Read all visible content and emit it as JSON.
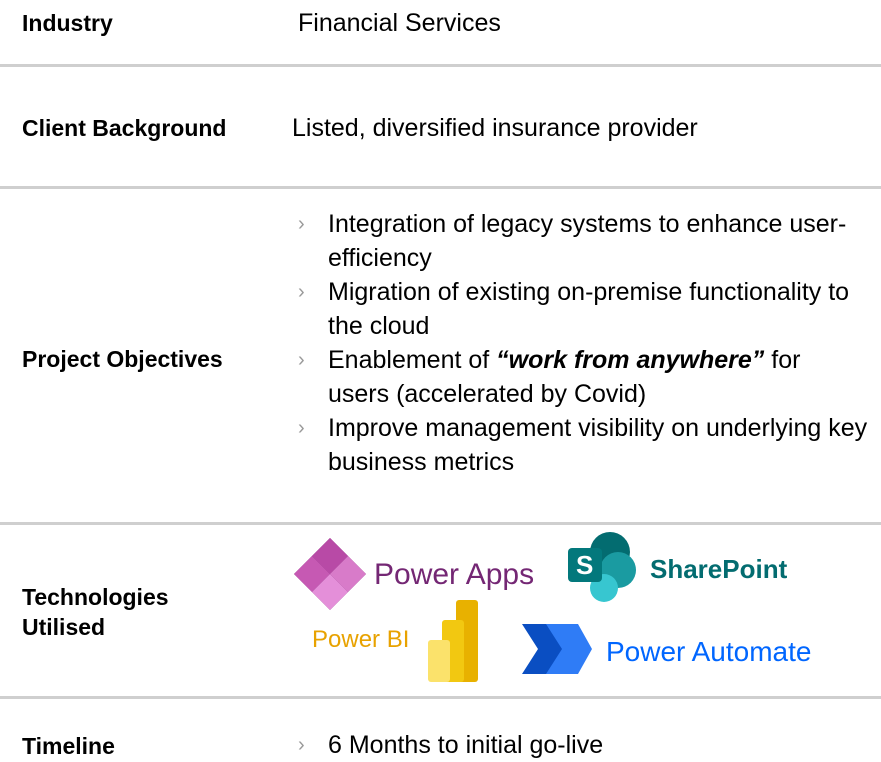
{
  "rows": {
    "industry": {
      "label": "Industry",
      "value": "Financial Services"
    },
    "client": {
      "label": "Client Background",
      "value": "Listed, diversified insurance provider"
    },
    "objectives": {
      "label": "Project Objectives",
      "items": [
        {
          "text": "Integration of legacy systems to enhance user-efficiency"
        },
        {
          "text": "Migration of existing on-premise functionality to the cloud"
        },
        {
          "pre": "Enablement of ",
          "emph": "“work from anywhere”",
          "post": " for users (accelerated by Covid)"
        },
        {
          "text": "Improve management visibility on underlying key business metrics"
        }
      ]
    },
    "technologies": {
      "label_line1": "Technologies",
      "label_line2": "Utilised",
      "logos": {
        "power_apps": "Power Apps",
        "sharepoint": "SharePoint",
        "sharepoint_letter": "S",
        "power_bi": "Power BI",
        "power_automate": "Power Automate"
      }
    },
    "timeline": {
      "label": "Timeline",
      "value": "6 Months to initial go-live"
    }
  },
  "colors": {
    "divider": "#cfcfcf",
    "power_apps_text": "#742774",
    "sharepoint_green": "#036c70",
    "sharepoint_teal": "#1a9ba1",
    "power_automate_blue": "#0066ff",
    "power_bi_yellow": "#f2c811",
    "bullet_chevron": "#9a9a9a"
  },
  "icons": [
    "chevron-right-icon",
    "power-apps-logo-icon",
    "sharepoint-logo-icon",
    "power-bi-logo-icon",
    "power-automate-logo-icon"
  ]
}
